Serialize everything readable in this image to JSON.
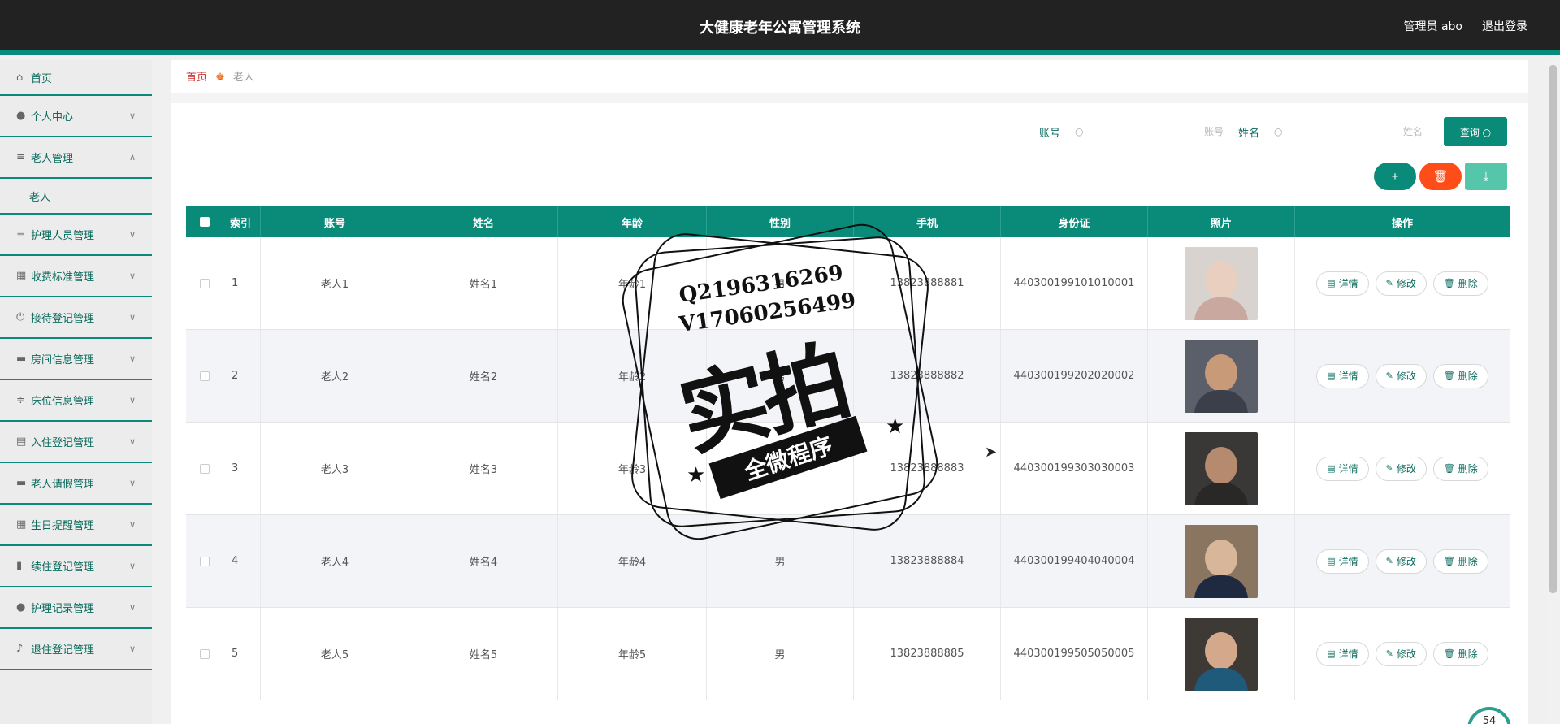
{
  "header": {
    "title": "大健康老年公寓管理系统",
    "user": "管理员 abo",
    "logout": "退出登录"
  },
  "sidebar": {
    "items": [
      {
        "label": "首页",
        "icon": "home-icon",
        "glyph": "⌂",
        "chevron": ""
      },
      {
        "label": "个人中心",
        "icon": "user-icon",
        "glyph": "●",
        "chevron": "∨"
      },
      {
        "label": "老人管理",
        "icon": "list-icon",
        "glyph": "≡",
        "chevron": "∧"
      },
      {
        "label": "护理人员管理",
        "icon": "list-icon",
        "glyph": "≡",
        "chevron": "∨"
      },
      {
        "label": "收费标准管理",
        "icon": "calculator-icon",
        "glyph": "▦",
        "chevron": "∨"
      },
      {
        "label": "接待登记管理",
        "icon": "power-icon",
        "glyph": "⏻",
        "chevron": "∨"
      },
      {
        "label": "房间信息管理",
        "icon": "monitor-icon",
        "glyph": "▬",
        "chevron": "∨"
      },
      {
        "label": "床位信息管理",
        "icon": "sliders-icon",
        "glyph": "≑",
        "chevron": "∨"
      },
      {
        "label": "入住登记管理",
        "icon": "clipboard-icon",
        "glyph": "▤",
        "chevron": "∨"
      },
      {
        "label": "老人请假管理",
        "icon": "monitor-icon",
        "glyph": "▬",
        "chevron": "∨"
      },
      {
        "label": "生日提醒管理",
        "icon": "grid-icon",
        "glyph": "▦",
        "chevron": "∨"
      },
      {
        "label": "续住登记管理",
        "icon": "bar-chart-icon",
        "glyph": "▮",
        "chevron": "∨"
      },
      {
        "label": "护理记录管理",
        "icon": "user-icon",
        "glyph": "●",
        "chevron": "∨"
      },
      {
        "label": "退住登记管理",
        "icon": "mic-icon",
        "glyph": "♪",
        "chevron": "∨"
      }
    ],
    "submenu": "老人"
  },
  "breadcrumb": {
    "home": "首页",
    "sep": "♚",
    "current": "老人"
  },
  "search": {
    "account_label": "账号",
    "account_placeholder": "账号",
    "name_label": "姓名",
    "name_placeholder": "姓名",
    "query_label": "查询 ○",
    "search_glyph": "○"
  },
  "actions": {
    "add": "+",
    "delete": "🗑",
    "export": "⤓"
  },
  "table": {
    "headers": {
      "index": "索引",
      "account": "账号",
      "name": "姓名",
      "age": "年龄",
      "gender": "性别",
      "phone": "手机",
      "idcard": "身份证",
      "photo": "照片",
      "ops": "操作"
    },
    "rows": [
      {
        "index": "1",
        "account": "老人1",
        "name": "姓名1",
        "age": "年龄1",
        "gender": "男",
        "phone": "13823888881",
        "idcard": "440300199101010001"
      },
      {
        "index": "2",
        "account": "老人2",
        "name": "姓名2",
        "age": "年龄2",
        "gender": "男",
        "phone": "13823888882",
        "idcard": "440300199202020002"
      },
      {
        "index": "3",
        "account": "老人3",
        "name": "姓名3",
        "age": "年龄3",
        "gender": "男",
        "phone": "13823888883",
        "idcard": "440300199303030003"
      },
      {
        "index": "4",
        "account": "老人4",
        "name": "姓名4",
        "age": "年龄4",
        "gender": "男",
        "phone": "13823888884",
        "idcard": "440300199404040004"
      },
      {
        "index": "5",
        "account": "老人5",
        "name": "姓名5",
        "age": "年龄5",
        "gender": "男",
        "phone": "13823888885",
        "idcard": "440300199505050005"
      }
    ],
    "ops": {
      "detail": "详情",
      "edit": "修改",
      "delete": "删除"
    }
  },
  "watermark": {
    "line1": "Q2196316269",
    "line2": "V17060256499",
    "big": "实拍",
    "banner": "全微程序"
  },
  "float_value": "54",
  "colors": {
    "primary": "#0a8a78",
    "danger": "#ff4d1a",
    "header_bg": "#222222"
  }
}
